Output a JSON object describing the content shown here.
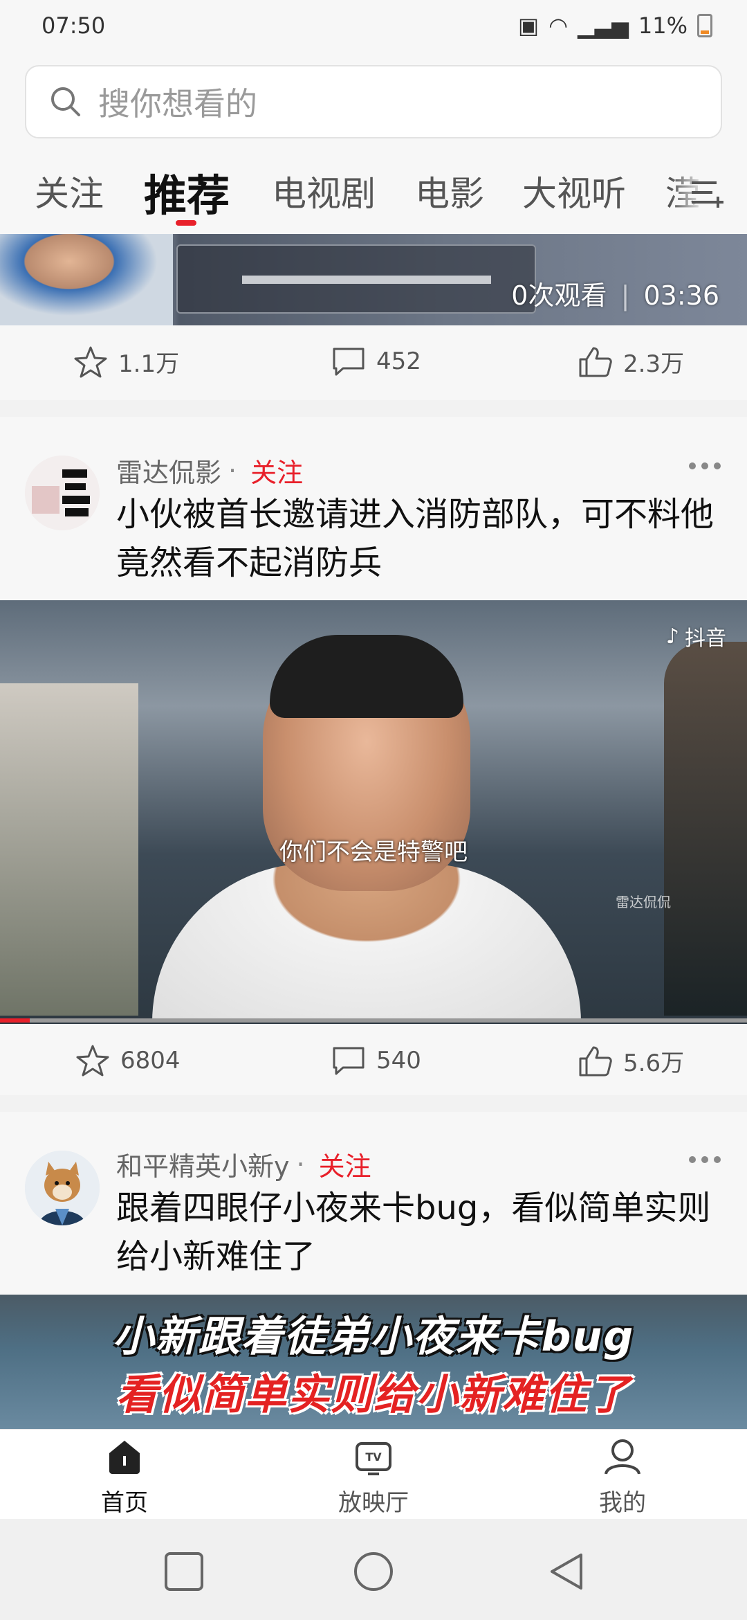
{
  "status_bar": {
    "time": "07:50",
    "battery": "11%"
  },
  "search": {
    "placeholder": "搜你想看的"
  },
  "tabs": [
    {
      "label": "关注"
    },
    {
      "label": "推荐"
    },
    {
      "label": "电视剧"
    },
    {
      "label": "电影"
    },
    {
      "label": "大视听"
    },
    {
      "label": "滢"
    }
  ],
  "feed": [
    {
      "views": "0次观看",
      "duration": "03:36",
      "stats": {
        "favorites": "1.1万",
        "comments": "452",
        "likes": "2.3万"
      }
    },
    {
      "author": "雷达侃影",
      "follow_label": "关注",
      "title": "小伙被首长邀请进入消防部队，可不料他竟然看不起消防兵",
      "video_subtitle": "你们不会是特警吧",
      "watermark": "抖音",
      "channel_watermark": "雷达侃侃",
      "progress": 0.04,
      "stats": {
        "favorites": "6804",
        "comments": "540",
        "likes": "5.6万"
      }
    },
    {
      "author": "和平精英小新y",
      "follow_label": "关注",
      "title": "跟着四眼仔小夜来卡bug，看似简单实则给小新难住了",
      "banner_line1": "小新跟着徒弟小夜来卡bug",
      "banner_line2": "看似简单实则给小新难住了"
    }
  ],
  "bottom_nav": [
    {
      "label": "首页",
      "icon": "home-icon",
      "active": true
    },
    {
      "label": "放映厅",
      "icon": "tv-icon",
      "active": false
    },
    {
      "label": "我的",
      "icon": "profile-icon",
      "active": false
    }
  ],
  "colors": {
    "accent": "#e8202a"
  }
}
